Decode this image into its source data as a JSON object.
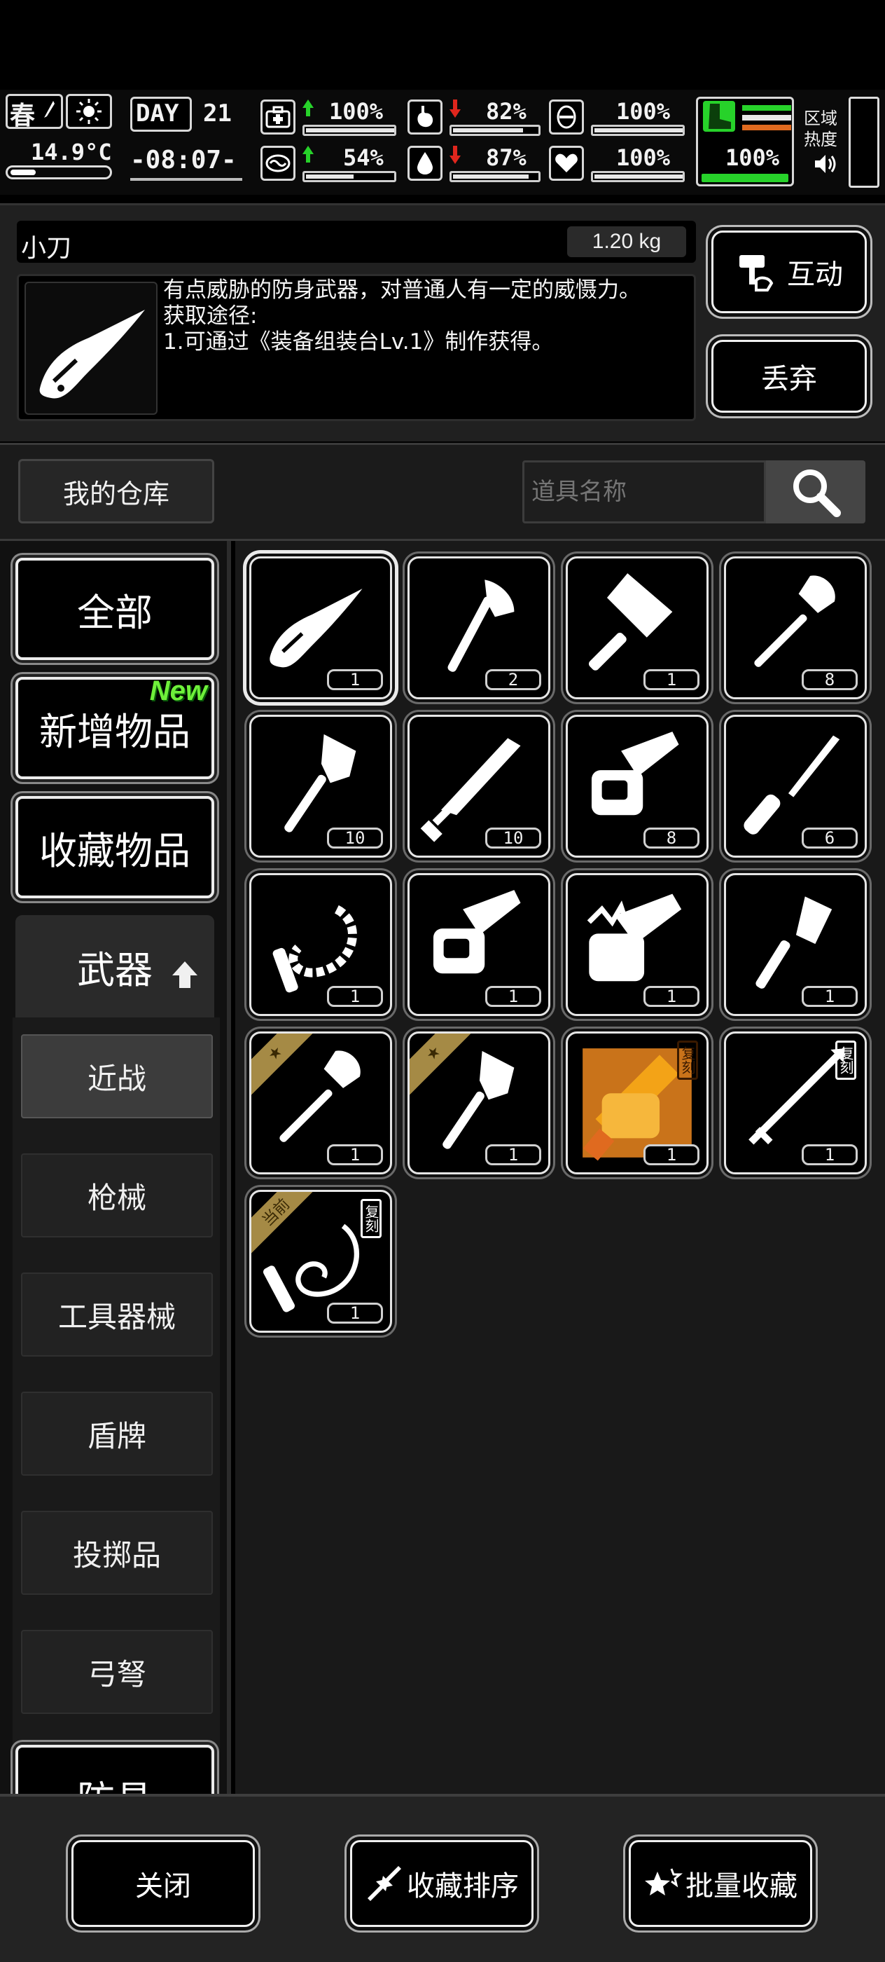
{
  "hud": {
    "season": "春",
    "temperature": "14.9°C",
    "day_label": "DAY",
    "day_number": "21",
    "clock": "-08:07-",
    "stats": [
      {
        "name": "health",
        "value": "100%",
        "trend": "up",
        "level": 1.0
      },
      {
        "name": "hunger",
        "value": "82%",
        "trend": "down",
        "level": 0.82
      },
      {
        "name": "shield",
        "value": "100%",
        "trend": "none",
        "level": 1.0
      },
      {
        "name": "mental",
        "value": "54%",
        "trend": "up",
        "level": 0.54
      },
      {
        "name": "thirst",
        "value": "87%",
        "trend": "down",
        "level": 0.87
      },
      {
        "name": "heart",
        "value": "100%",
        "trend": "none",
        "level": 1.0
      }
    ],
    "stamina_value": "100%",
    "zone_heat_label": "区域\n热度"
  },
  "detail": {
    "name": "小刀",
    "weight": "1.20 kg",
    "description": "有点威胁的防身武器，对普通人有一定的威慑力。\n获取途径:\n1.可通过《装备组装台Lv.1》制作获得。",
    "interact_label": "互动",
    "discard_label": "丢弃"
  },
  "storage": {
    "title": "我的仓库",
    "search_placeholder": "道具名称"
  },
  "sidebar": {
    "categories": [
      {
        "label": "全部"
      },
      {
        "label": "新增物品",
        "badge": "New"
      },
      {
        "label": "收藏物品"
      }
    ],
    "expanded_category": "武器",
    "subcategories": [
      "近战",
      "枪械",
      "工具器械",
      "盾牌",
      "投掷品",
      "弓弩"
    ],
    "next_category_partial": "防具"
  },
  "items": [
    {
      "icon": "knife-icon",
      "qty": "1",
      "selected": true
    },
    {
      "icon": "axe-icon",
      "qty": "2"
    },
    {
      "icon": "cleaver-icon",
      "qty": "1"
    },
    {
      "icon": "shovel-icon",
      "qty": "8"
    },
    {
      "icon": "battle-axe-icon",
      "qty": "10"
    },
    {
      "icon": "greatsword-icon",
      "qty": "10"
    },
    {
      "icon": "chainsaw-icon",
      "qty": "8"
    },
    {
      "icon": "screwdriver-icon",
      "qty": "6"
    },
    {
      "icon": "bone-whip-icon",
      "qty": "1"
    },
    {
      "icon": "chainsaw-icon",
      "qty": "1"
    },
    {
      "icon": "demon-chainsaw-icon",
      "qty": "1"
    },
    {
      "icon": "spatula-icon",
      "qty": "1"
    },
    {
      "icon": "shovel-icon",
      "qty": "1",
      "ribbon": "★"
    },
    {
      "icon": "battle-axe-icon",
      "qty": "1",
      "ribbon": "★"
    },
    {
      "icon": "golden-chainsaw-icon",
      "qty": "1",
      "replica": "复刻"
    },
    {
      "icon": "spear-icon",
      "qty": "1",
      "replica": "复刻"
    },
    {
      "icon": "whip-icon",
      "qty": "1",
      "ribbon": "当前",
      "replica": "复刻"
    }
  ],
  "footer": {
    "close_label": "关闭",
    "sort_label": "收藏排序",
    "batch_label": "批量收藏"
  },
  "colors": {
    "accent_green": "#27d22a",
    "alert_red": "#e0261d",
    "ribbon_gold": "#a58a45",
    "replica_orange": "#f3a317",
    "new_green": "#6ff03a"
  }
}
